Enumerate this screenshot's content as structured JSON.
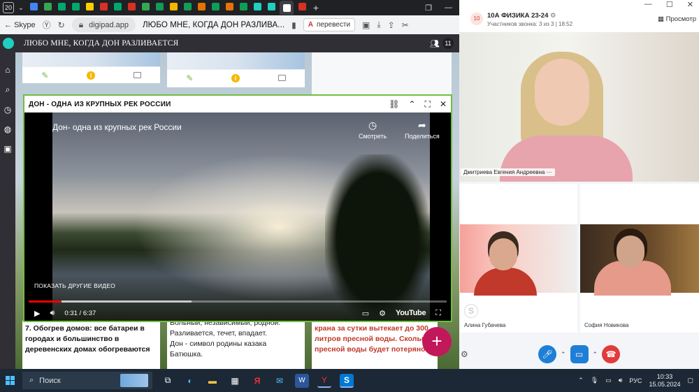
{
  "browser": {
    "tab_count": "20",
    "tab_favicon_colors": [
      "#4285f4",
      "#34a853",
      "#00a86b",
      "#00a86b",
      "#ffcc00",
      "#d93025",
      "#00a86b",
      "#d93025",
      "#34a853",
      "#0f9d58",
      "#f4b400",
      "#0f9d58",
      "#e37400",
      "#0f9d58",
      "#e8710a",
      "#0f9d58",
      "#1fd0c0",
      "#1fd0c0",
      "#ffffff",
      "#d93025"
    ],
    "back_label": "Skype",
    "url_domain": "digipad.app",
    "page_title": "ЛЮБО МНЕ, КОГДА ДОН РАЗЛИВА...",
    "translate_label": "перевести"
  },
  "digipad": {
    "pad_title": "ЛЮБО МНЕ, КОГДА ДОН РАЗЛИВАЕТСЯ",
    "user_count": "11",
    "fab_label": "+",
    "card_left_text": "7. Обогрев домов: все батареи в городах и большинство в деревенских домах обогреваются",
    "card_mid_text_top": "Вольный, независимый, родной.",
    "card_mid_text": "Разливается, течет, впадает.",
    "card_mid_text2": "Дон - символ родины казака",
    "card_mid_text3": "Батюшка.",
    "card_right_text": "крана за сутки вытекает до 300 литров пресной воды. Сколько пресной воды будет потеряно"
  },
  "video_modal": {
    "title": "ДОН - ОДНА ИЗ КРУПНЫХ РЕК РОССИИ",
    "video_title": "Дон- одна из крупных рек России",
    "watch_label": "Смотреть",
    "share_label": "Поделиться",
    "more_videos_label": "ПОКАЗАТЬ ДРУГИЕ ВИДЕО",
    "time_current": "0:31",
    "time_total": "6:37",
    "time_display": "0:31 / 6:37",
    "played_fraction": 0.078,
    "loaded_fraction": 0.39,
    "youtube_label": "YouTube"
  },
  "skype": {
    "group_avatar": "10",
    "group_name": "10А ФИЗИКА 23-24",
    "group_sub": "Участников звонка: 3 из 3 | 18:52",
    "view_label": "Просмотр",
    "main_participant": "Дмитриева Евгения Андреевна",
    "participant_left": "Алина Губачева",
    "participant_right": "София Новикова"
  },
  "taskbar": {
    "search_label": "Поиск",
    "lang": "РУС",
    "time": "10:33",
    "date": "15.05.2024"
  }
}
